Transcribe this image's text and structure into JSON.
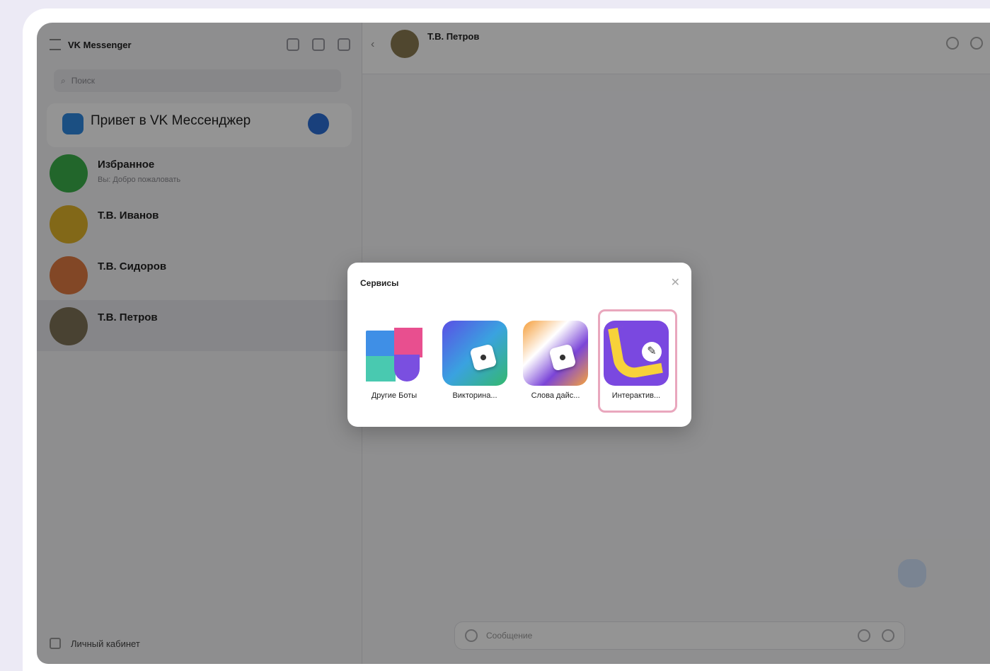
{
  "sidebar": {
    "title": "VK Messenger",
    "search_placeholder": "Поиск",
    "pinned": {
      "title": "Привет в VK Мессенджер",
      "subtitle": ""
    },
    "chats": [
      {
        "name": "Избранное",
        "preview": "Вы: Добро пожаловать",
        "time": ""
      },
      {
        "name": "Т.В. Иванов",
        "preview": "",
        "time": ""
      },
      {
        "name": "Т.В. Сидоров",
        "preview": "",
        "time": ""
      },
      {
        "name": "Т.В. Петров",
        "preview": "",
        "time": ""
      }
    ],
    "bottom_label": "Личный кабинет",
    "version": ""
  },
  "chat": {
    "header_name": "Т.В. Петров",
    "header_status": "",
    "message": "",
    "composer_placeholder": "Сообщение"
  },
  "modal": {
    "title": "Сервисы",
    "close_icon": "✕",
    "apps": [
      {
        "label": "Другие Боты"
      },
      {
        "label": "Викторина..."
      },
      {
        "label": "Слова дайс..."
      },
      {
        "label": "Интерактив..."
      }
    ]
  },
  "colors": {
    "accent": "#2b6fd6",
    "highlight": "#e9a7bd"
  }
}
